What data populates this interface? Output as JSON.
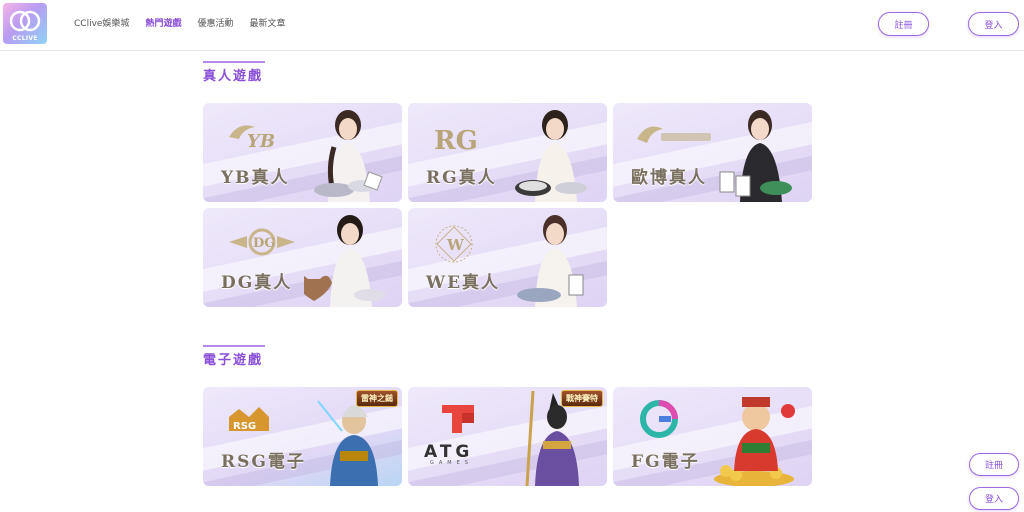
{
  "header": {
    "logo_text": "CCLIVE",
    "nav": [
      {
        "label": "CClive娛樂城",
        "active": false
      },
      {
        "label": "熱門遊戲",
        "active": true
      },
      {
        "label": "優惠活動",
        "active": false
      },
      {
        "label": "最新文章",
        "active": false
      }
    ],
    "register_label": "註冊",
    "login_label": "登入"
  },
  "sections": [
    {
      "title": "真人遊戲",
      "cards": [
        {
          "label": "YB真人",
          "brand": "YB"
        },
        {
          "label": "RG真人",
          "brand": "RG"
        },
        {
          "label": "歐博真人",
          "brand": "allbet"
        },
        {
          "label": "DG真人",
          "brand": "DG"
        },
        {
          "label": "WE真人",
          "brand": "W"
        }
      ]
    },
    {
      "title": "電子遊戲",
      "cards": [
        {
          "label": "RSG電子",
          "brand": "RSG",
          "badge": "雷神之鎚"
        },
        {
          "label": "",
          "brand": "ATG",
          "brand_text": "ATG",
          "brand_sub": "GAMES",
          "badge": "戰神賽特"
        },
        {
          "label": "FG電子",
          "brand": "FG"
        }
      ]
    }
  ],
  "floating": {
    "register_label": "註冊",
    "login_label": "登入"
  },
  "colors": {
    "accent": "#8a4fd8",
    "card_bg": "#e6ddf7",
    "label_gold": "#7a7060"
  }
}
